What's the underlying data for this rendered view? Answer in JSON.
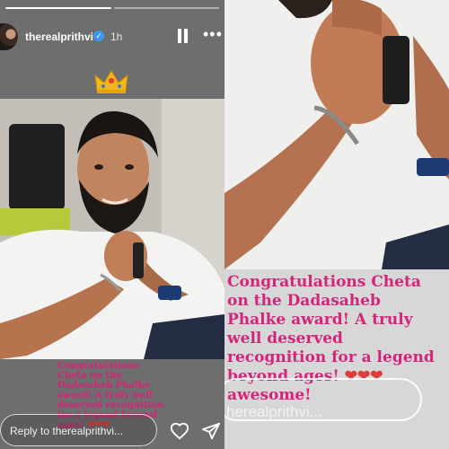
{
  "story": {
    "username": "therealprithvi",
    "time_ago": "1h",
    "verified_mark": "✓",
    "crown_emoji": "👑",
    "caption": "Congratulations Cheta on the Dadasaheb Phalke award! A truly well deserved recognition for a legend beyond ages!",
    "hearts": "❤❤❤",
    "reply_placeholder": "Reply to therealprithvi...",
    "icons": [
      "pause-icon",
      "more-options-icon",
      "heart-icon",
      "send-icon",
      "verified-badge-icon"
    ],
    "progress_segments": 2,
    "active_segment": 1
  },
  "zoom": {
    "caption_line1": "Congratulations Cheta",
    "caption_line2": "on the Dadasaheb",
    "caption_line3": "Phalke award! A truly",
    "caption_line4": "well deserved",
    "caption_line5": "recognition for a legend",
    "caption_line6": "beyond ages!",
    "hearts": "❤❤❤",
    "partial_line": "awesome!",
    "reply_partial": "herealprithvi..."
  },
  "colors": {
    "caption": "#d6247a",
    "verified": "#3897f0",
    "hearts": "#e23b3b"
  }
}
